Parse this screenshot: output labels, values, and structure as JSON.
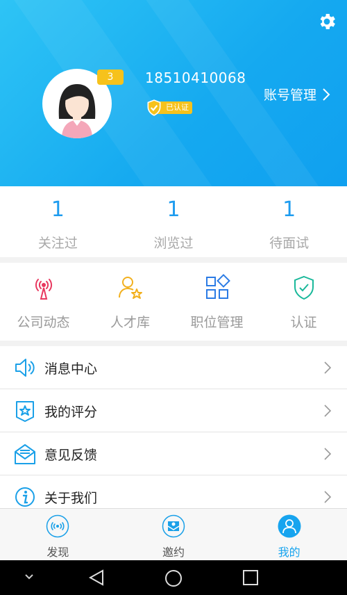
{
  "header": {
    "level": "3",
    "phone": "18510410068",
    "verified_label": "已认证",
    "account_label": "账号管理"
  },
  "stats": [
    {
      "value": "1",
      "label": "关注过"
    },
    {
      "value": "1",
      "label": "浏览过"
    },
    {
      "value": "1",
      "label": "待面试"
    }
  ],
  "quick_actions": [
    {
      "label": "公司动态",
      "icon": "broadcast-icon"
    },
    {
      "label": "人才库",
      "icon": "talent-icon"
    },
    {
      "label": "职位管理",
      "icon": "grid-icon"
    },
    {
      "label": "认证",
      "icon": "shield-check-icon"
    }
  ],
  "menu": [
    {
      "label": "消息中心",
      "icon": "speaker-icon"
    },
    {
      "label": "我的评分",
      "icon": "star-badge-icon"
    },
    {
      "label": "意见反馈",
      "icon": "envelope-icon"
    },
    {
      "label": "关于我们",
      "icon": "info-icon"
    }
  ],
  "tabs": [
    {
      "label": "发现",
      "icon": "discover-icon",
      "active": false
    },
    {
      "label": "邀约",
      "icon": "invite-icon",
      "active": false
    },
    {
      "label": "我的",
      "icon": "profile-icon",
      "active": true
    }
  ],
  "colors": {
    "header": "#17a8f0",
    "accent": "#1e9cef",
    "badge": "#f6c21c"
  }
}
